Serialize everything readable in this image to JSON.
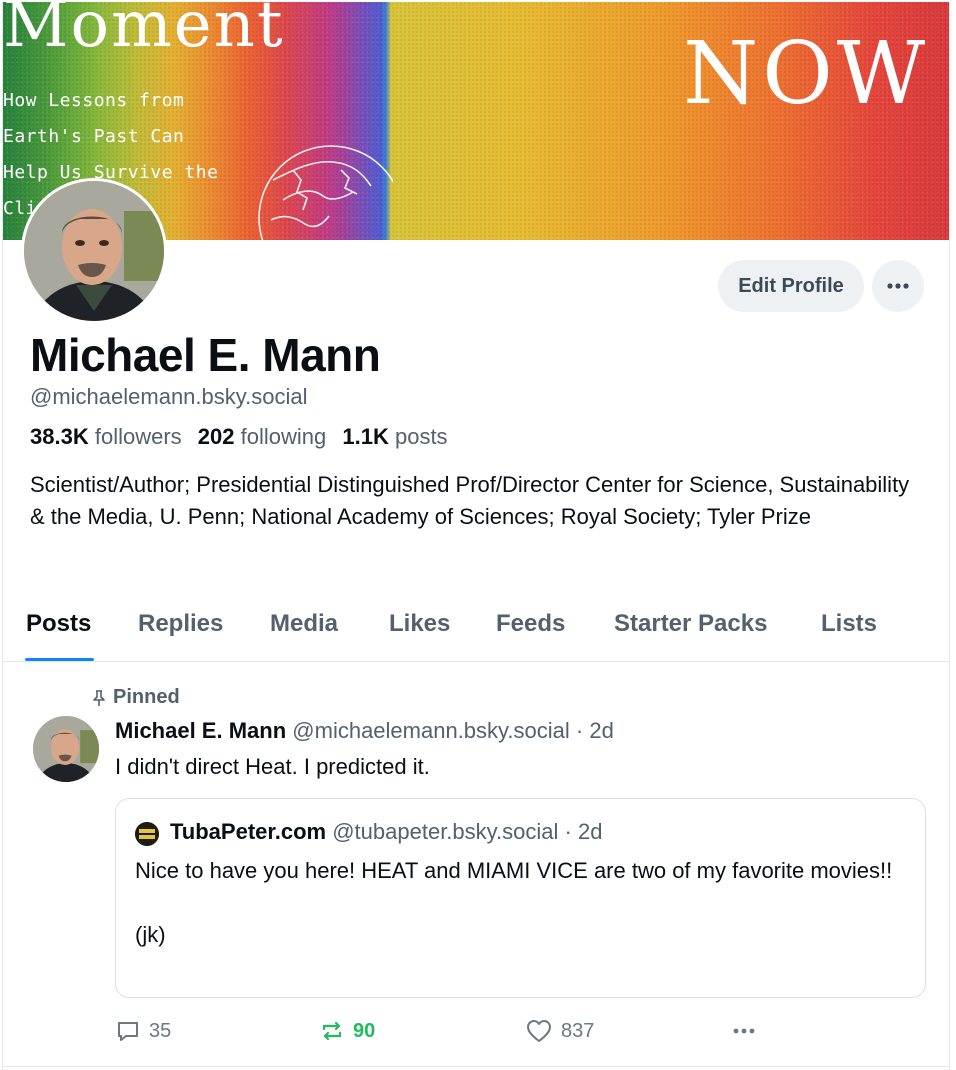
{
  "banner": {
    "title": "Moment",
    "subtitle_lines": [
      "How Lessons from",
      "Earth's Past Can",
      "Help Us Survive the",
      "Cli"
    ],
    "right_text": "NOW"
  },
  "profile": {
    "name": "Michael E. Mann",
    "handle": "@michaelemann.bsky.social",
    "followers_count": "38.3K",
    "followers_label": "followers",
    "following_count": "202",
    "following_label": "following",
    "posts_count": "1.1K",
    "posts_label": "posts",
    "bio": "Scientist/Author; Presidential Distinguished Prof/Director Center for Science, Sustainability & the Media, U. Penn; National Academy of Sciences; Royal Society; Tyler Prize",
    "edit_label": "Edit Profile",
    "more_icon": "ellipsis-icon"
  },
  "tabs": [
    {
      "label": "Posts",
      "active": true
    },
    {
      "label": "Replies",
      "active": false
    },
    {
      "label": "Media",
      "active": false
    },
    {
      "label": "Likes",
      "active": false
    },
    {
      "label": "Feeds",
      "active": false
    },
    {
      "label": "Starter Packs",
      "active": false
    },
    {
      "label": "Lists",
      "active": false
    }
  ],
  "post": {
    "pinned_label": "Pinned",
    "author_name": "Michael E. Mann",
    "author_handle": "@michaelemann.bsky.social",
    "separator": "·",
    "time": "2d",
    "text": "I didn't direct Heat. I predicted it.",
    "quote": {
      "author_name": "TubaPeter.com",
      "author_handle": "@tubapeter.bsky.social",
      "time": "2d",
      "text": "Nice to have you here! HEAT and MIAMI VICE are two of my favorite movies!!\n\n(jk)"
    },
    "actions": {
      "reply_count": "35",
      "repost_count": "90",
      "like_count": "837"
    }
  },
  "colors": {
    "accent": "#1185fe",
    "repost": "#20bc5e",
    "muted": "#53606e"
  }
}
